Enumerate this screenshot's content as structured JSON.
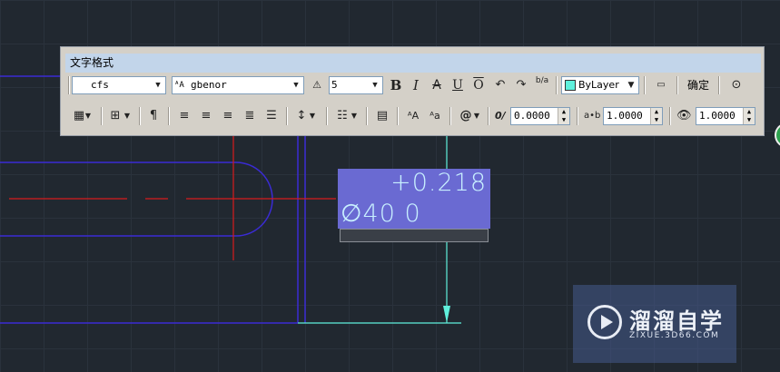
{
  "toolbar": {
    "title": "文字格式",
    "style_value": "cfs",
    "font_value": "gbenor",
    "height_value": "5",
    "bold_label": "B",
    "italic_label": "I",
    "strike_label": "A",
    "underline_label": "U",
    "overline_label": "O",
    "stack_label": "b/a",
    "color_value": "ByLayer",
    "ok_label": "确定",
    "oblique_value": "0.0000",
    "tracking_label": "a•b",
    "tracking_value": "1.0000",
    "width_value": "1.0000",
    "symbol_label": "@"
  },
  "text_editor": {
    "upper_line": "+0.218",
    "lower_line": "∅40  0"
  },
  "watermark": {
    "name": "溜溜自学",
    "url": "ZIXUE.3D66.COM"
  },
  "colors": {
    "canvas": "#212830",
    "toolbar_bg": "#d4d0c8",
    "title_bar": "#c2d5ea",
    "selection": "#6a6ad2",
    "cyan_line": "#5ff0dc",
    "blue_line": "#3a2bd4",
    "red_line": "#d81c1c",
    "layer_swatch": "#5ff0dc"
  }
}
